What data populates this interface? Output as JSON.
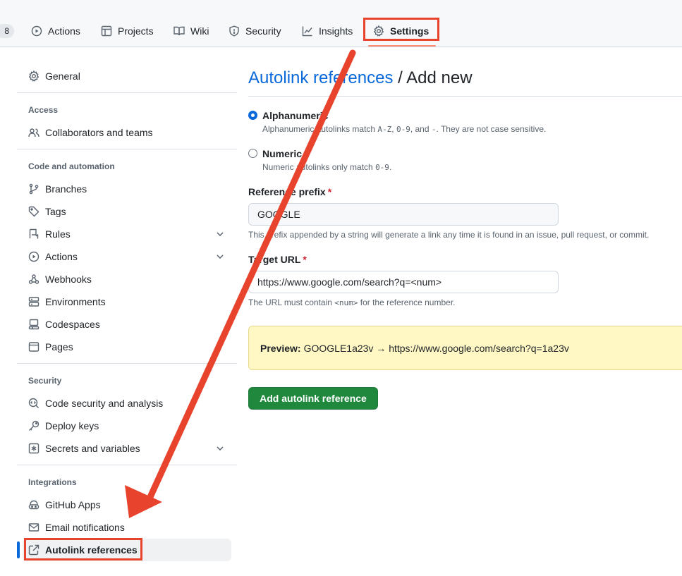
{
  "repo_nav": {
    "counter": "8",
    "tabs": [
      {
        "label": "Actions",
        "icon": "play-icon"
      },
      {
        "label": "Projects",
        "icon": "table-icon"
      },
      {
        "label": "Wiki",
        "icon": "book-icon"
      },
      {
        "label": "Security",
        "icon": "shield-icon"
      },
      {
        "label": "Insights",
        "icon": "graph-icon"
      },
      {
        "label": "Settings",
        "icon": "gear-icon",
        "selected": true
      }
    ]
  },
  "sidebar": {
    "general": "General",
    "sections": [
      {
        "heading": "Access",
        "items": [
          {
            "label": "Collaborators and teams",
            "icon": "people-icon"
          }
        ]
      },
      {
        "heading": "Code and automation",
        "items": [
          {
            "label": "Branches",
            "icon": "git-branch-icon"
          },
          {
            "label": "Tags",
            "icon": "tag-icon"
          },
          {
            "label": "Rules",
            "icon": "repo-push-icon",
            "expandable": true
          },
          {
            "label": "Actions",
            "icon": "play-icon",
            "expandable": true
          },
          {
            "label": "Webhooks",
            "icon": "webhook-icon"
          },
          {
            "label": "Environments",
            "icon": "server-icon"
          },
          {
            "label": "Codespaces",
            "icon": "codespaces-icon"
          },
          {
            "label": "Pages",
            "icon": "browser-icon"
          }
        ]
      },
      {
        "heading": "Security",
        "items": [
          {
            "label": "Code security and analysis",
            "icon": "codescan-icon"
          },
          {
            "label": "Deploy keys",
            "icon": "key-icon"
          },
          {
            "label": "Secrets and variables",
            "icon": "asterisk-icon",
            "expandable": true
          }
        ]
      },
      {
        "heading": "Integrations",
        "items": [
          {
            "label": "GitHub Apps",
            "icon": "apps-icon"
          },
          {
            "label": "Email notifications",
            "icon": "mail-icon"
          },
          {
            "label": "Autolink references",
            "icon": "link-external-icon",
            "active": true
          }
        ]
      }
    ]
  },
  "main": {
    "title_link": "Autolink references",
    "title_rest": " / Add new",
    "format_options": [
      {
        "label": "Alphanumeric",
        "checked": true,
        "note_parts": [
          "Alphanumeric autolinks match ",
          "A-Z",
          ", ",
          "0-9",
          ", and ",
          "-",
          ". They are not case sensitive."
        ]
      },
      {
        "label": "Numeric",
        "checked": false,
        "note_parts": [
          "Numeric autolinks only match ",
          "0-9",
          "."
        ]
      }
    ],
    "prefix": {
      "label": "Reference prefix",
      "required_mark": "*",
      "value": "GOOGLE",
      "hint": "This prefix appended by a string will generate a link any time it is found in an issue, pull request, or commit."
    },
    "target": {
      "label": "Target URL",
      "required_mark": "*",
      "value": "https://www.google.com/search?q=<num>",
      "hint_pre": "The URL must contain ",
      "hint_code": "<num>",
      "hint_post": " for the reference number."
    },
    "preview": {
      "label": "Preview:",
      "text": "GOOGLE1a23v → https://www.google.com/search?q=1a23v"
    },
    "submit_label": "Add autolink reference"
  },
  "annotation_color": "#e8432d"
}
